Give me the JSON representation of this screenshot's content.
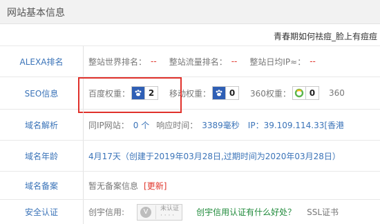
{
  "header": {
    "title": "网站基本信息"
  },
  "site_title": "青春期如何祛痘_脸上有痘痘",
  "alexa": {
    "label": "ALEXA排名",
    "items": [
      {
        "key": "整站世界排名：",
        "value": "--"
      },
      {
        "key": "整站流量排名：",
        "value": "--"
      },
      {
        "key": "整站日均IP≈：",
        "value": "--"
      }
    ]
  },
  "seo": {
    "label": "SEO信息",
    "baidu_key": "百度权重：",
    "baidu_value": "2",
    "mobile_key": "移动权重：",
    "mobile_value": "0",
    "s360_key": "360权重：",
    "s360_value": "0",
    "tail": "360",
    "colors": {
      "paw_bg": "#2f5fb5",
      "ring_360": "#5bb64c",
      "highlight": "#e0302a"
    },
    "icons": [
      "baidu-paw-icon",
      "mobile-paw-icon",
      "360-ring-icon"
    ]
  },
  "dns": {
    "label": "域名解析",
    "same_ip_key": "同IP网站：",
    "same_ip_value": "0 个",
    "resp_key": "响应时间：",
    "resp_value": "3389毫秒",
    "ip_key": "IP：",
    "ip_value": "39.109.114.33[香港"
  },
  "age": {
    "label": "域名年龄",
    "text": "4月17天（创建于2019年03月28日,过期时间为2020年03月28日）"
  },
  "beian": {
    "label": "域名备案",
    "text": "暂无备案信息",
    "update": "[更新]"
  },
  "security": {
    "label": "安全认证",
    "key": "创宇信用:",
    "badge_text": "未认证",
    "badge_sub": "· · · ·",
    "link": "创宇信用认证有什么好处？",
    "tail": "SSL证书"
  }
}
